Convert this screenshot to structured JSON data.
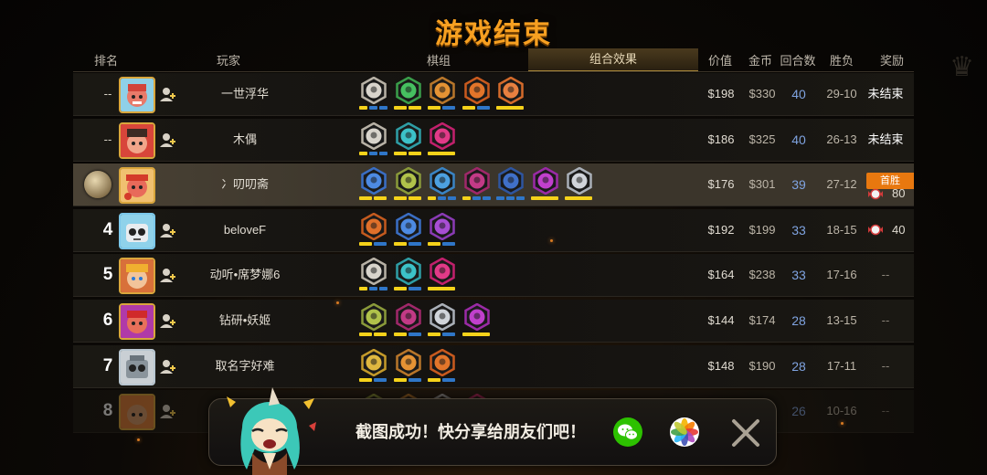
{
  "title": "游戏结束",
  "headers": {
    "rank": "排名",
    "player": "玩家",
    "pieces": "棋组",
    "combo": "组合效果",
    "value": "价值",
    "gold": "金币",
    "rounds": "回合数",
    "winloss": "胜负",
    "reward": "奖励"
  },
  "rows": [
    {
      "rank": "--",
      "name": "一世浮华",
      "value": "$198",
      "gold": "$330",
      "rounds": "40",
      "wl": "29-10",
      "reward": "未结束"
    },
    {
      "rank": "--",
      "name": "木偶",
      "value": "$186",
      "gold": "$325",
      "rounds": "40",
      "wl": "26-13",
      "reward": "未结束"
    },
    {
      "rank": "",
      "name": "冫叨叨斋",
      "value": "$176",
      "gold": "$301",
      "rounds": "39",
      "wl": "27-12",
      "reward_flag": "首胜",
      "reward": "80"
    },
    {
      "rank": "4",
      "name": "beloveF",
      "value": "$192",
      "gold": "$199",
      "rounds": "33",
      "wl": "18-15",
      "reward": "40"
    },
    {
      "rank": "5",
      "name": "动听•席梦娜6",
      "value": "$164",
      "gold": "$238",
      "rounds": "33",
      "wl": "17-16",
      "reward": "--"
    },
    {
      "rank": "6",
      "name": "钻研•妖姬",
      "value": "$144",
      "gold": "$174",
      "rounds": "28",
      "wl": "13-15",
      "reward": "--"
    },
    {
      "rank": "7",
      "name": "取名字好难",
      "value": "$148",
      "gold": "$190",
      "rounds": "28",
      "wl": "17-11",
      "reward": "--"
    },
    {
      "rank": "8",
      "name": "",
      "value": "",
      "gold": "",
      "rounds": "26",
      "wl": "10-16",
      "reward": "--"
    }
  ],
  "toast": {
    "message": "截图成功！快分享给朋友们吧！",
    "share_wechat_icon": "wechat-icon",
    "share_photos_icon": "photos-icon",
    "close_icon": "close-icon"
  },
  "colors": {
    "title": "#f7a021",
    "accent": "#a58437",
    "round_blue": "#7fa3e0",
    "bar_yellow": "#f5d21a",
    "bar_blue": "#2f76c8",
    "reward_flag": "#e8780f"
  },
  "synergies": [
    [
      {
        "icon": "warrior-icon",
        "ring": "#b8b2a6",
        "fill": "#d8d4cc",
        "lvl": 1,
        "max": 3
      },
      {
        "icon": "beast-icon",
        "ring": "#3a9e4a",
        "fill": "#46c060",
        "lvl": 2,
        "max": 2
      },
      {
        "icon": "mech-icon",
        "ring": "#b8762a",
        "fill": "#e59334",
        "lvl": 1,
        "max": 2
      },
      {
        "icon": "demon-hunter-icon",
        "ring": "#c95a1e",
        "fill": "#e2752a",
        "lvl": 1,
        "max": 2
      },
      {
        "icon": "horned-demon-icon",
        "ring": "#d46a2a",
        "fill": "#e88040",
        "lvl": 1,
        "max": 1
      }
    ],
    [
      {
        "icon": "warrior-icon",
        "ring": "#b8b2a6",
        "fill": "#d8d4cc",
        "lvl": 1,
        "max": 3
      },
      {
        "icon": "mystery-icon",
        "ring": "#2e9ea6",
        "fill": "#3cc2c8",
        "lvl": 2,
        "max": 2
      },
      {
        "icon": "assassin-icon",
        "ring": "#c2206c",
        "fill": "#e23a88",
        "lvl": 1,
        "max": 1
      }
    ],
    [
      {
        "icon": "storm-icon",
        "ring": "#3a6ec4",
        "fill": "#4d8ae2",
        "lvl": 2,
        "max": 2
      },
      {
        "icon": "troll-icon",
        "ring": "#8a9a3a",
        "fill": "#b0c24a",
        "lvl": 2,
        "max": 2
      },
      {
        "icon": "swarm-icon",
        "ring": "#3a84c4",
        "fill": "#4ca0e0",
        "lvl": 1,
        "max": 3
      },
      {
        "icon": "knight-icon",
        "ring": "#a0286a",
        "fill": "#c23a86",
        "lvl": 1,
        "max": 3
      },
      {
        "icon": "goblin-mech-icon",
        "ring": "#2e55a0",
        "fill": "#4070c8",
        "lvl": 0,
        "max": 3
      },
      {
        "icon": "imp-icon",
        "ring": "#9a2aa6",
        "fill": "#c040cc",
        "lvl": 1,
        "max": 1
      },
      {
        "icon": "priest-icon",
        "ring": "#aab0b8",
        "fill": "#d0d4da",
        "lvl": 1,
        "max": 1
      }
    ],
    [
      {
        "icon": "feather-icon",
        "ring": "#c45a1e",
        "fill": "#e0702a",
        "lvl": 1,
        "max": 2
      },
      {
        "icon": "wing-icon",
        "ring": "#3a6ec4",
        "fill": "#4d8ae2",
        "lvl": 1,
        "max": 2
      },
      {
        "icon": "witch-icon",
        "ring": "#8a3ab4",
        "fill": "#a84ed4",
        "lvl": 1,
        "max": 2
      }
    ],
    [
      {
        "icon": "warrior-icon",
        "ring": "#b8b2a6",
        "fill": "#d8d4cc",
        "lvl": 1,
        "max": 3
      },
      {
        "icon": "mystery-icon",
        "ring": "#2e9ea6",
        "fill": "#3cc2c8",
        "lvl": 1,
        "max": 2
      },
      {
        "icon": "assassin-icon",
        "ring": "#c2206c",
        "fill": "#e23a88",
        "lvl": 1,
        "max": 1
      }
    ],
    [
      {
        "icon": "troll-icon",
        "ring": "#8a9a3a",
        "fill": "#b0c24a",
        "lvl": 2,
        "max": 2
      },
      {
        "icon": "knight-icon",
        "ring": "#a0286a",
        "fill": "#c23a86",
        "lvl": 1,
        "max": 2
      },
      {
        "icon": "priest-icon",
        "ring": "#aab0b8",
        "fill": "#d0d4da",
        "lvl": 1,
        "max": 2
      },
      {
        "icon": "imp-icon",
        "ring": "#9a2aa6",
        "fill": "#c040cc",
        "lvl": 1,
        "max": 1
      }
    ],
    [
      {
        "icon": "lightning-icon",
        "ring": "#c49a2a",
        "fill": "#e0b840",
        "lvl": 1,
        "max": 2
      },
      {
        "icon": "mech-icon",
        "ring": "#b8762a",
        "fill": "#e59334",
        "lvl": 1,
        "max": 2
      },
      {
        "icon": "demon-hunter-icon",
        "ring": "#c95a1e",
        "fill": "#e2752a",
        "lvl": 1,
        "max": 2
      }
    ],
    [
      {
        "icon": "troll-icon",
        "ring": "#8a9a3a",
        "fill": "#b0c24a",
        "lvl": 0,
        "max": 2
      },
      {
        "icon": "mech-icon",
        "ring": "#b8762a",
        "fill": "#e59334",
        "lvl": 0,
        "max": 2
      },
      {
        "icon": "priest-icon",
        "ring": "#aab0b8",
        "fill": "#d0d4da",
        "lvl": 0,
        "max": 2
      },
      {
        "icon": "assassin-icon",
        "ring": "#c2206c",
        "fill": "#e23a88",
        "lvl": 0,
        "max": 1
      }
    ]
  ]
}
